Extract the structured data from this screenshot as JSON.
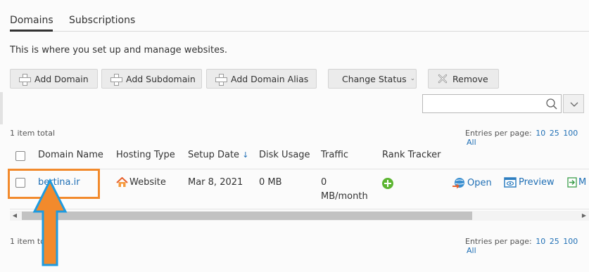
{
  "tabs": [
    {
      "label": "Domains",
      "active": true
    },
    {
      "label": "Subscriptions",
      "active": false
    }
  ],
  "intro": "This is where you set up and manage websites.",
  "toolbar": {
    "add_domain": "Add Domain",
    "add_subdomain": "Add Subdomain",
    "add_domain_alias": "Add Domain Alias",
    "change_status": "Change Status",
    "remove": "Remove"
  },
  "search": {
    "value": "",
    "placeholder": ""
  },
  "list_meta": {
    "total_top": "1 item total",
    "total_bottom": "1 item to",
    "entries_label": "Entries per page:",
    "entries_options": [
      "10",
      "25",
      "100",
      "All"
    ]
  },
  "table": {
    "headers": {
      "domain_name": "Domain Name",
      "hosting_type": "Hosting Type",
      "setup_date": "Setup Date",
      "sort_indicator": "↓",
      "disk_usage": "Disk Usage",
      "traffic": "Traffic",
      "rank_tracker": "Rank Tracker"
    },
    "rows": [
      {
        "domain": "bertina.ir",
        "hosting_type": "Website",
        "setup_date": "Mar 8, 2021",
        "disk_usage": "0 MB",
        "traffic_value": "0",
        "traffic_unit": "MB/month",
        "actions": {
          "open": "Open",
          "preview": "Preview",
          "more": "M"
        }
      }
    ]
  },
  "colors": {
    "link": "#1f6fb5",
    "highlight_box": "#f28a2c",
    "arrow_fill": "#f28a2c",
    "arrow_outline": "#1e9be0",
    "rank_icon": "#5cb531"
  }
}
